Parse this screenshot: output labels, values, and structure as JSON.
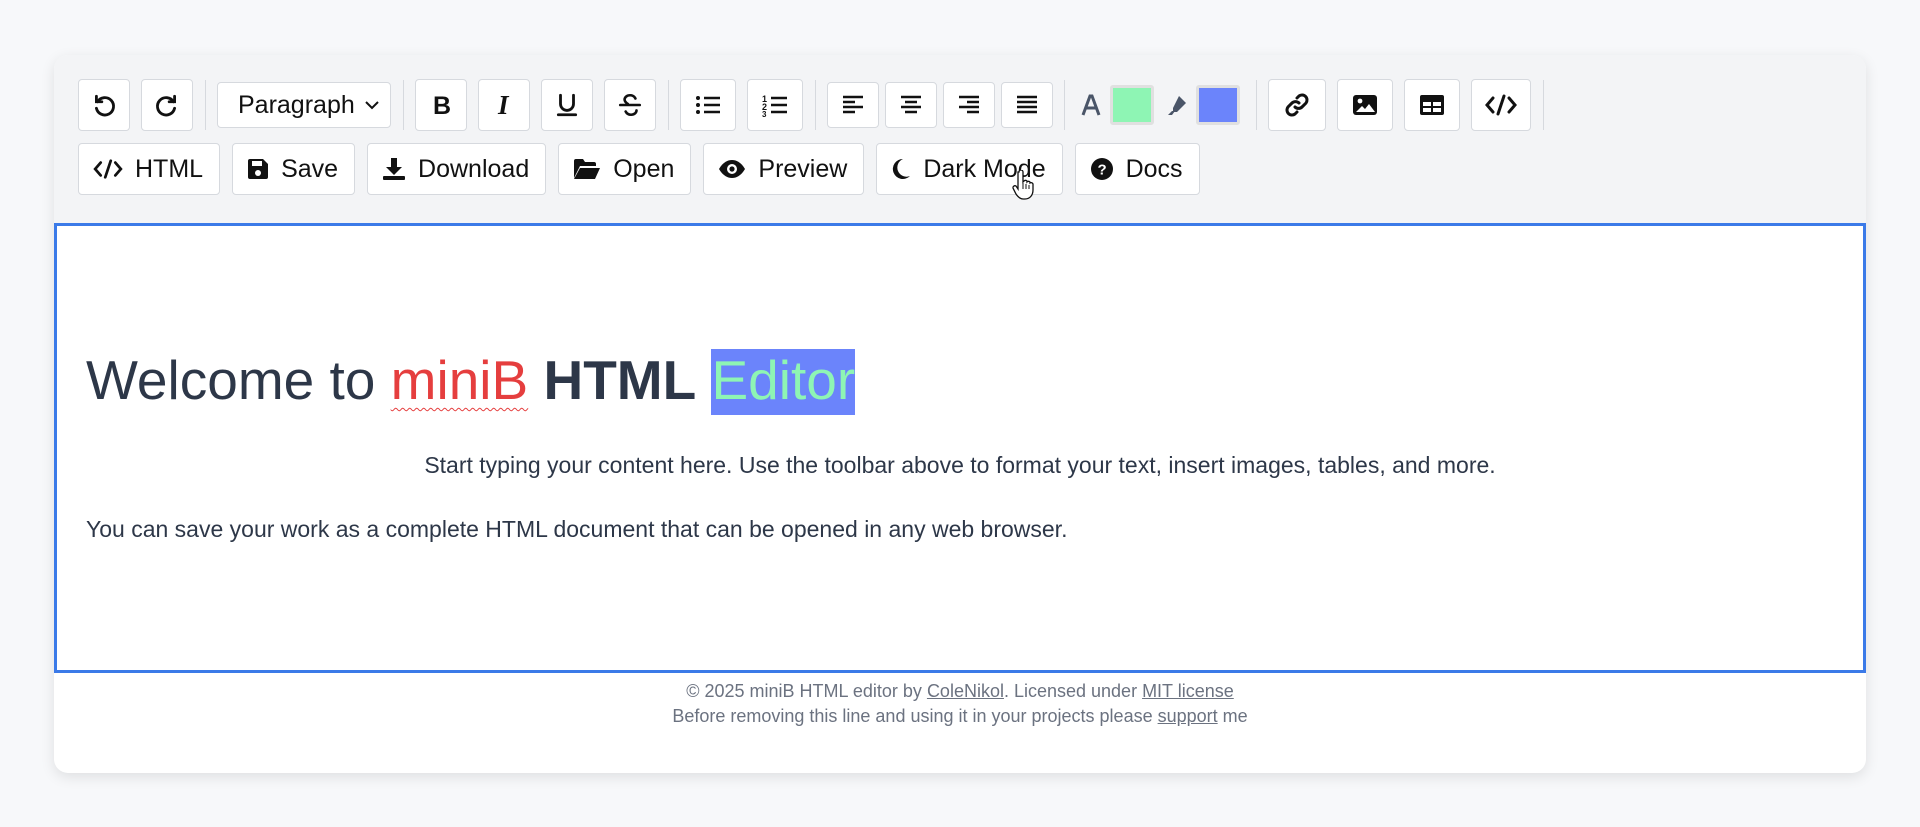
{
  "toolbar": {
    "block_format": "Paragraph",
    "text_color": "#8ef5b4",
    "highlight_color": "#6b84fb",
    "icons_row1": [
      "undo-icon",
      "redo-icon",
      "bold-icon",
      "italic-icon",
      "underline-icon",
      "strikethrough-icon",
      "bullet-list-icon",
      "numbered-list-icon",
      "align-left-icon",
      "align-center-icon",
      "align-right-icon",
      "align-justify-icon",
      "text-color-icon",
      "highlighter-icon",
      "link-icon",
      "image-icon",
      "table-icon",
      "code-icon"
    ],
    "buttons": {
      "html": "HTML",
      "save": "Save",
      "download": "Download",
      "open": "Open",
      "preview": "Preview",
      "dark_mode": "Dark Mode",
      "docs": "Docs"
    }
  },
  "editor": {
    "heading": {
      "part1": "Welcome to ",
      "part2": "miniB",
      "part3": "HTML",
      "part4": "Editor"
    },
    "paragraph1": "Start typing your content here. Use the toolbar above to format your text, insert images, tables, and more.",
    "paragraph2": "You can save your work as a complete HTML document that can be opened in any web browser."
  },
  "footer": {
    "line1_a": "© 2025 miniB HTML editor by ",
    "line1_link1": "ColeNikol",
    "line1_b": ". Licensed under ",
    "line1_link2": "MIT license",
    "line2_a": "Before removing this line and using it in your projects please ",
    "line2_link": "support",
    "line2_b": " me"
  },
  "colors": {
    "accent": "#3b7ae8",
    "error": "#e53e3e"
  }
}
